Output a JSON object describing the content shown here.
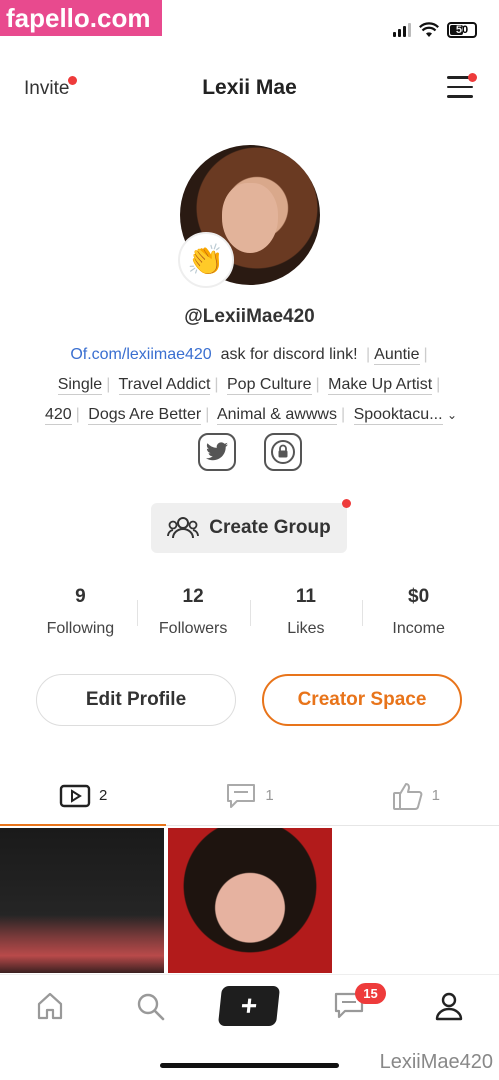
{
  "watermark": {
    "top": "fapello.com",
    "bottom": "LexiiMae420"
  },
  "status_bar": {
    "battery": "50"
  },
  "header": {
    "invite_label": "Invite",
    "title": "Lexii Mae"
  },
  "profile": {
    "handle": "@LexiiMae420"
  },
  "bio": {
    "link": "Of.com/lexiimae420",
    "text": "ask for discord link!",
    "tags": [
      "Auntie",
      "Single",
      "Travel Addict",
      "Pop Culture",
      "Make Up Artist",
      "420",
      "Dogs Are Better",
      "Animal & awwws",
      "Spooktacu..."
    ]
  },
  "actions": {
    "create_group": "Create Group",
    "edit_profile": "Edit Profile",
    "creator_space": "Creator Space"
  },
  "stats": [
    {
      "value": "9",
      "label": "Following"
    },
    {
      "value": "12",
      "label": "Followers"
    },
    {
      "value": "11",
      "label": "Likes"
    },
    {
      "value": "$0",
      "label": "Income"
    }
  ],
  "content_tabs": [
    {
      "icon": "video-icon",
      "count": "2"
    },
    {
      "icon": "comment-icon",
      "count": "1"
    },
    {
      "icon": "thumbs-up-icon",
      "count": "1"
    }
  ],
  "bottom_nav": {
    "messages_badge": "15",
    "plus": "+"
  },
  "colors": {
    "accent": "#e8741a",
    "link": "#3a6fd0",
    "badge": "#ee3b3b"
  }
}
